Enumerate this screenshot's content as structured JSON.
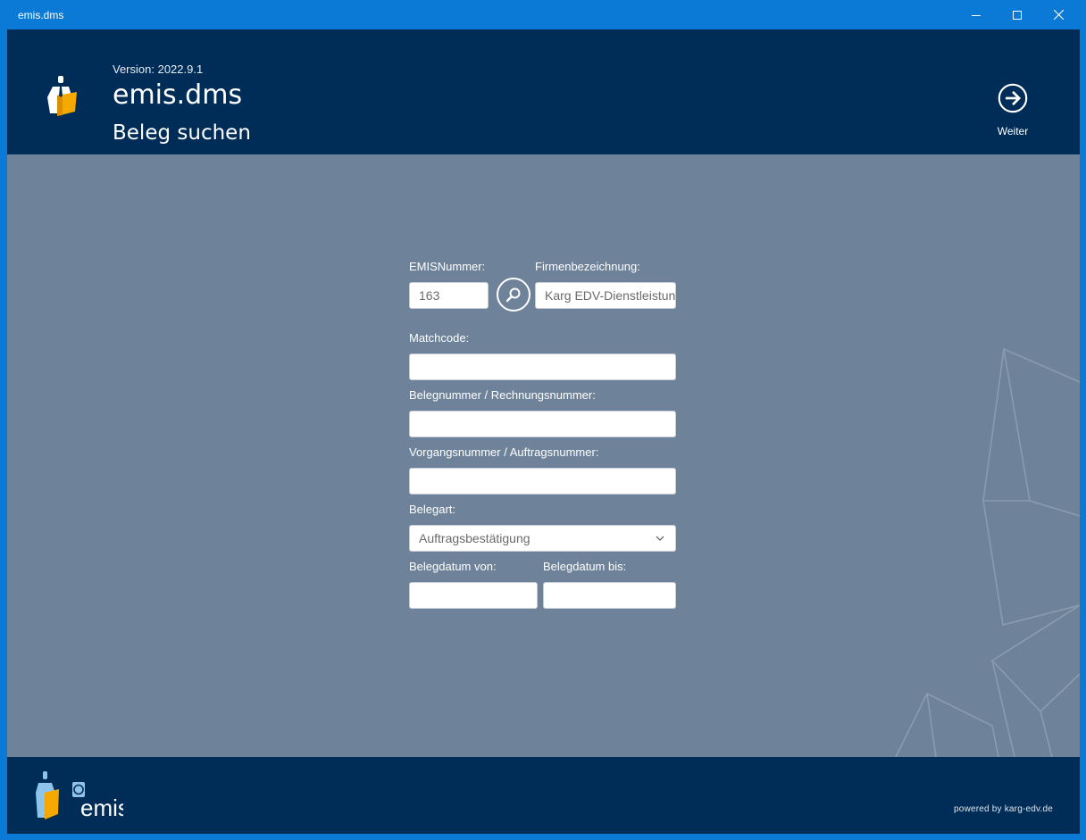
{
  "window": {
    "title": "emis.dms",
    "accent": "#0a7ad6",
    "controls": [
      "minimize-icon",
      "maximize-icon",
      "close-icon"
    ]
  },
  "header": {
    "version": "Version: 2022.9.1",
    "app_name": "emis.dms",
    "page_title": "Beleg suchen",
    "next_label": "Weiter",
    "background": "#002c58"
  },
  "form": {
    "emis_label": "EMISNummer:",
    "emis_value": "163",
    "firm_label": "Firmenbezeichnung:",
    "firm_value": "Karg EDV-Dienstleistun",
    "matchcode_label": "Matchcode:",
    "matchcode_value": "",
    "belegnummer_label": "Belegnummer / Rechnungsnummer:",
    "belegnummer_value": "",
    "vorgang_label": "Vorgangsnummer / Auftragsnummer:",
    "vorgang_value": "",
    "belegart_label": "Belegart:",
    "belegart_value": "Auftragsbestätigung",
    "datum_von_label": "Belegdatum von:",
    "datum_von_value": "",
    "datum_bis_label": "Belegdatum bis:",
    "datum_bis_value": ""
  },
  "footer": {
    "logo_text": "emis",
    "powered": "powered by karg-edv.de"
  }
}
